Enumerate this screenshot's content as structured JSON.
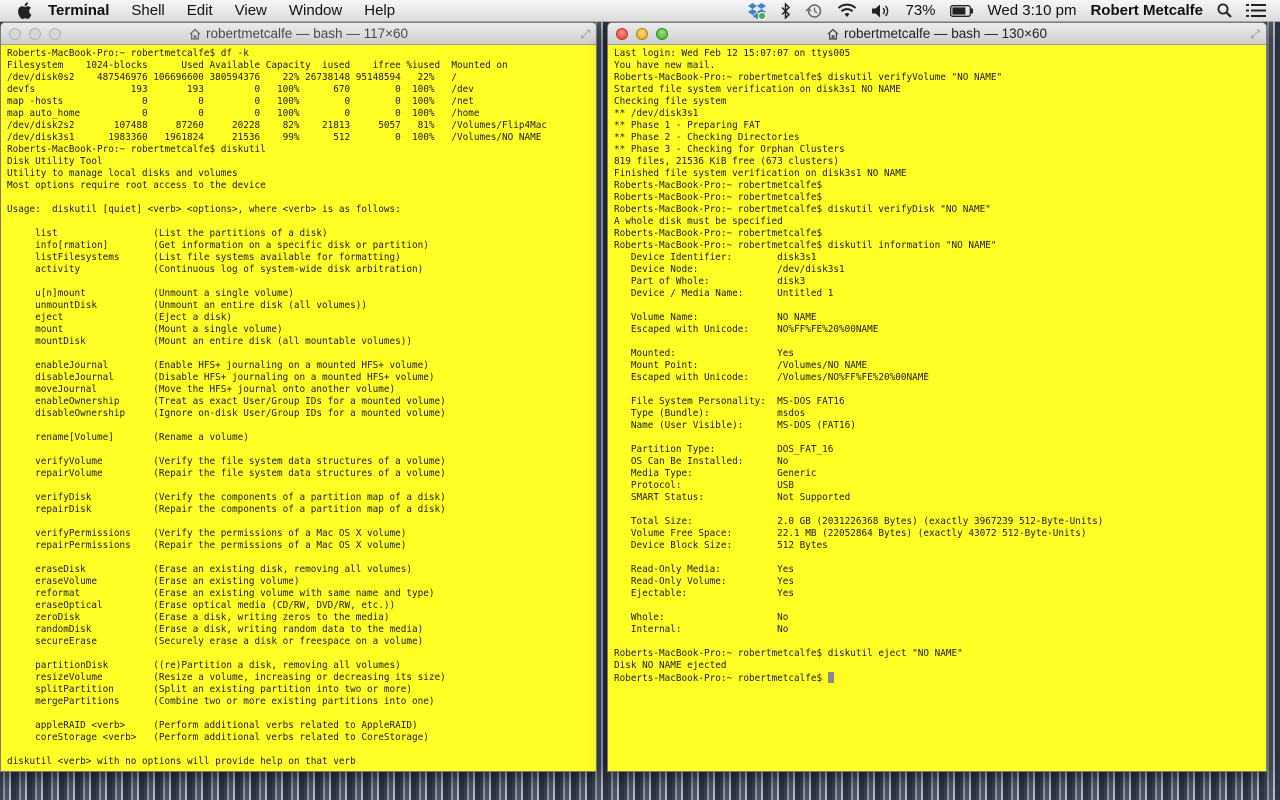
{
  "menubar": {
    "app_name": "Terminal",
    "items": [
      "Shell",
      "Edit",
      "View",
      "Window",
      "Help"
    ],
    "battery_pct": "73%",
    "clock": "Wed 3:10 pm",
    "user": "Robert Metcalfe"
  },
  "left_window": {
    "title": "robertmetcalfe — bash — 117×60",
    "lines": [
      "Roberts-MacBook-Pro:~ robertmetcalfe$ df -k",
      "Filesystem    1024-blocks      Used Available Capacity  iused    ifree %iused  Mounted on",
      "/dev/disk0s2    487546976 106696600 380594376    22% 26738148 95148594   22%   /",
      "devfs                 193       193         0   100%      670        0  100%   /dev",
      "map -hosts              0         0         0   100%        0        0  100%   /net",
      "map auto_home           0         0         0   100%        0        0  100%   /home",
      "/dev/disk2s2       107488     87260     20228    82%    21813     5057   81%   /Volumes/Flip4Mac",
      "/dev/disk3s1      1983360   1961824     21536    99%      512        0  100%   /Volumes/NO NAME",
      "Roberts-MacBook-Pro:~ robertmetcalfe$ diskutil",
      "Disk Utility Tool",
      "Utility to manage local disks and volumes",
      "Most options require root access to the device",
      "",
      "Usage:  diskutil [quiet] <verb> <options>, where <verb> is as follows:",
      "",
      "     list                 (List the partitions of a disk)",
      "     info[rmation]        (Get information on a specific disk or partition)",
      "     listFilesystems      (List file systems available for formatting)",
      "     activity             (Continuous log of system-wide disk arbitration)",
      "",
      "     u[n]mount            (Unmount a single volume)",
      "     unmountDisk          (Unmount an entire disk (all volumes))",
      "     eject                (Eject a disk)",
      "     mount                (Mount a single volume)",
      "     mountDisk            (Mount an entire disk (all mountable volumes))",
      "",
      "     enableJournal        (Enable HFS+ journaling on a mounted HFS+ volume)",
      "     disableJournal       (Disable HFS+ journaling on a mounted HFS+ volume)",
      "     moveJournal          (Move the HFS+ journal onto another volume)",
      "     enableOwnership      (Treat as exact User/Group IDs for a mounted volume)",
      "     disableOwnership     (Ignore on-disk User/Group IDs for a mounted volume)",
      "",
      "     rename[Volume]       (Rename a volume)",
      "",
      "     verifyVolume         (Verify the file system data structures of a volume)",
      "     repairVolume         (Repair the file system data structures of a volume)",
      "",
      "     verifyDisk           (Verify the components of a partition map of a disk)",
      "     repairDisk           (Repair the components of a partition map of a disk)",
      "",
      "     verifyPermissions    (Verify the permissions of a Mac OS X volume)",
      "     repairPermissions    (Repair the permissions of a Mac OS X volume)",
      "",
      "     eraseDisk            (Erase an existing disk, removing all volumes)",
      "     eraseVolume          (Erase an existing volume)",
      "     reformat             (Erase an existing volume with same name and type)",
      "     eraseOptical         (Erase optical media (CD/RW, DVD/RW, etc.))",
      "     zeroDisk             (Erase a disk, writing zeros to the media)",
      "     randomDisk           (Erase a disk, writing random data to the media)",
      "     secureErase          (Securely erase a disk or freespace on a volume)",
      "",
      "     partitionDisk        ((re)Partition a disk, removing all volumes)",
      "     resizeVolume         (Resize a volume, increasing or decreasing its size)",
      "     splitPartition       (Split an existing partition into two or more)",
      "     mergePartitions      (Combine two or more existing partitions into one)",
      "",
      "     appleRAID <verb>     (Perform additional verbs related to AppleRAID)",
      "     coreStorage <verb>   (Perform additional verbs related to CoreStorage)",
      "",
      "diskutil <verb> with no options will provide help on that verb"
    ]
  },
  "right_window": {
    "title": "robertmetcalfe — bash — 130×60",
    "lines": [
      "Last login: Wed Feb 12 15:07:07 on ttys005",
      "You have new mail.",
      "Roberts-MacBook-Pro:~ robertmetcalfe$ diskutil verifyVolume \"NO NAME\"",
      "Started file system verification on disk3s1 NO NAME",
      "Checking file system",
      "** /dev/disk3s1",
      "** Phase 1 - Preparing FAT",
      "** Phase 2 - Checking Directories",
      "** Phase 3 - Checking for Orphan Clusters",
      "819 files, 21536 KiB free (673 clusters)",
      "Finished file system verification on disk3s1 NO NAME",
      "Roberts-MacBook-Pro:~ robertmetcalfe$",
      "Roberts-MacBook-Pro:~ robertmetcalfe$",
      "Roberts-MacBook-Pro:~ robertmetcalfe$ diskutil verifyDisk \"NO NAME\"",
      "A whole disk must be specified",
      "Roberts-MacBook-Pro:~ robertmetcalfe$",
      "Roberts-MacBook-Pro:~ robertmetcalfe$ diskutil information \"NO NAME\"",
      "   Device Identifier:        disk3s1",
      "   Device Node:              /dev/disk3s1",
      "   Part of Whole:            disk3",
      "   Device / Media Name:      Untitled 1",
      "",
      "   Volume Name:              NO NAME",
      "   Escaped with Unicode:     NO%FF%FE%20%00NAME",
      "",
      "   Mounted:                  Yes",
      "   Mount Point:              /Volumes/NO NAME",
      "   Escaped with Unicode:     /Volumes/NO%FF%FE%20%00NAME",
      "",
      "   File System Personality:  MS-DOS FAT16",
      "   Type (Bundle):            msdos",
      "   Name (User Visible):      MS-DOS (FAT16)",
      "",
      "   Partition Type:           DOS_FAT_16",
      "   OS Can Be Installed:      No",
      "   Media Type:               Generic",
      "   Protocol:                 USB",
      "   SMART Status:             Not Supported",
      "",
      "   Total Size:               2.0 GB (2031226368 Bytes) (exactly 3967239 512-Byte-Units)",
      "   Volume Free Space:        22.1 MB (22052864 Bytes) (exactly 43072 512-Byte-Units)",
      "   Device Block Size:        512 Bytes",
      "",
      "   Read-Only Media:          Yes",
      "   Read-Only Volume:         Yes",
      "   Ejectable:                Yes",
      "",
      "   Whole:                    No",
      "   Internal:                 No",
      "",
      "Roberts-MacBook-Pro:~ robertmetcalfe$ diskutil eject \"NO NAME\"",
      "Disk NO NAME ejected",
      "Roberts-MacBook-Pro:~ robertmetcalfe$ "
    ]
  }
}
